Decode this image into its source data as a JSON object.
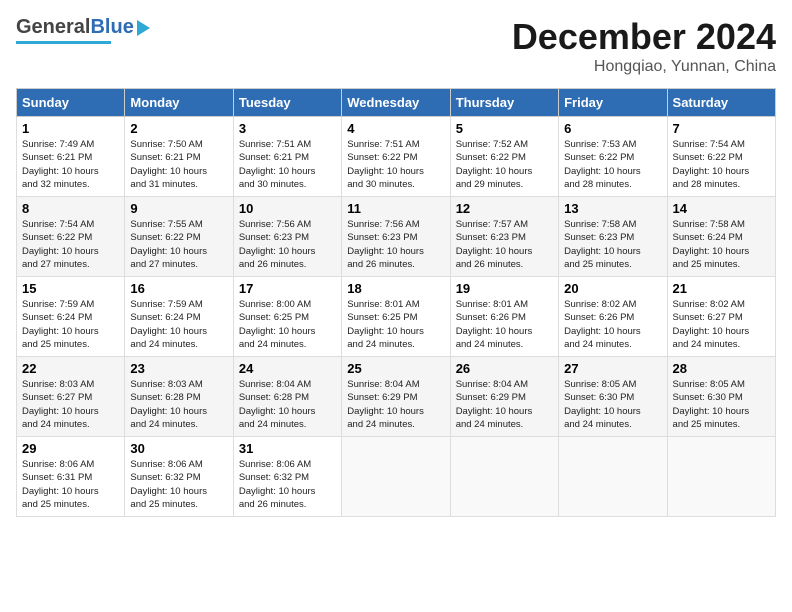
{
  "header": {
    "logo_general": "General",
    "logo_blue": "Blue",
    "month_title": "December 2024",
    "location": "Hongqiao, Yunnan, China"
  },
  "calendar": {
    "days_of_week": [
      "Sunday",
      "Monday",
      "Tuesday",
      "Wednesday",
      "Thursday",
      "Friday",
      "Saturday"
    ],
    "weeks": [
      [
        {
          "day": "1",
          "sunrise": "7:49 AM",
          "sunset": "6:21 PM",
          "daylight": "10 hours and 32 minutes."
        },
        {
          "day": "2",
          "sunrise": "7:50 AM",
          "sunset": "6:21 PM",
          "daylight": "10 hours and 31 minutes."
        },
        {
          "day": "3",
          "sunrise": "7:51 AM",
          "sunset": "6:21 PM",
          "daylight": "10 hours and 30 minutes."
        },
        {
          "day": "4",
          "sunrise": "7:51 AM",
          "sunset": "6:22 PM",
          "daylight": "10 hours and 30 minutes."
        },
        {
          "day": "5",
          "sunrise": "7:52 AM",
          "sunset": "6:22 PM",
          "daylight": "10 hours and 29 minutes."
        },
        {
          "day": "6",
          "sunrise": "7:53 AM",
          "sunset": "6:22 PM",
          "daylight": "10 hours and 28 minutes."
        },
        {
          "day": "7",
          "sunrise": "7:54 AM",
          "sunset": "6:22 PM",
          "daylight": "10 hours and 28 minutes."
        }
      ],
      [
        {
          "day": "8",
          "sunrise": "7:54 AM",
          "sunset": "6:22 PM",
          "daylight": "10 hours and 27 minutes."
        },
        {
          "day": "9",
          "sunrise": "7:55 AM",
          "sunset": "6:22 PM",
          "daylight": "10 hours and 27 minutes."
        },
        {
          "day": "10",
          "sunrise": "7:56 AM",
          "sunset": "6:23 PM",
          "daylight": "10 hours and 26 minutes."
        },
        {
          "day": "11",
          "sunrise": "7:56 AM",
          "sunset": "6:23 PM",
          "daylight": "10 hours and 26 minutes."
        },
        {
          "day": "12",
          "sunrise": "7:57 AM",
          "sunset": "6:23 PM",
          "daylight": "10 hours and 26 minutes."
        },
        {
          "day": "13",
          "sunrise": "7:58 AM",
          "sunset": "6:23 PM",
          "daylight": "10 hours and 25 minutes."
        },
        {
          "day": "14",
          "sunrise": "7:58 AM",
          "sunset": "6:24 PM",
          "daylight": "10 hours and 25 minutes."
        }
      ],
      [
        {
          "day": "15",
          "sunrise": "7:59 AM",
          "sunset": "6:24 PM",
          "daylight": "10 hours and 25 minutes."
        },
        {
          "day": "16",
          "sunrise": "7:59 AM",
          "sunset": "6:24 PM",
          "daylight": "10 hours and 24 minutes."
        },
        {
          "day": "17",
          "sunrise": "8:00 AM",
          "sunset": "6:25 PM",
          "daylight": "10 hours and 24 minutes."
        },
        {
          "day": "18",
          "sunrise": "8:01 AM",
          "sunset": "6:25 PM",
          "daylight": "10 hours and 24 minutes."
        },
        {
          "day": "19",
          "sunrise": "8:01 AM",
          "sunset": "6:26 PM",
          "daylight": "10 hours and 24 minutes."
        },
        {
          "day": "20",
          "sunrise": "8:02 AM",
          "sunset": "6:26 PM",
          "daylight": "10 hours and 24 minutes."
        },
        {
          "day": "21",
          "sunrise": "8:02 AM",
          "sunset": "6:27 PM",
          "daylight": "10 hours and 24 minutes."
        }
      ],
      [
        {
          "day": "22",
          "sunrise": "8:03 AM",
          "sunset": "6:27 PM",
          "daylight": "10 hours and 24 minutes."
        },
        {
          "day": "23",
          "sunrise": "8:03 AM",
          "sunset": "6:28 PM",
          "daylight": "10 hours and 24 minutes."
        },
        {
          "day": "24",
          "sunrise": "8:04 AM",
          "sunset": "6:28 PM",
          "daylight": "10 hours and 24 minutes."
        },
        {
          "day": "25",
          "sunrise": "8:04 AM",
          "sunset": "6:29 PM",
          "daylight": "10 hours and 24 minutes."
        },
        {
          "day": "26",
          "sunrise": "8:04 AM",
          "sunset": "6:29 PM",
          "daylight": "10 hours and 24 minutes."
        },
        {
          "day": "27",
          "sunrise": "8:05 AM",
          "sunset": "6:30 PM",
          "daylight": "10 hours and 24 minutes."
        },
        {
          "day": "28",
          "sunrise": "8:05 AM",
          "sunset": "6:30 PM",
          "daylight": "10 hours and 25 minutes."
        }
      ],
      [
        {
          "day": "29",
          "sunrise": "8:06 AM",
          "sunset": "6:31 PM",
          "daylight": "10 hours and 25 minutes."
        },
        {
          "day": "30",
          "sunrise": "8:06 AM",
          "sunset": "6:32 PM",
          "daylight": "10 hours and 25 minutes."
        },
        {
          "day": "31",
          "sunrise": "8:06 AM",
          "sunset": "6:32 PM",
          "daylight": "10 hours and 26 minutes."
        },
        null,
        null,
        null,
        null
      ]
    ]
  }
}
